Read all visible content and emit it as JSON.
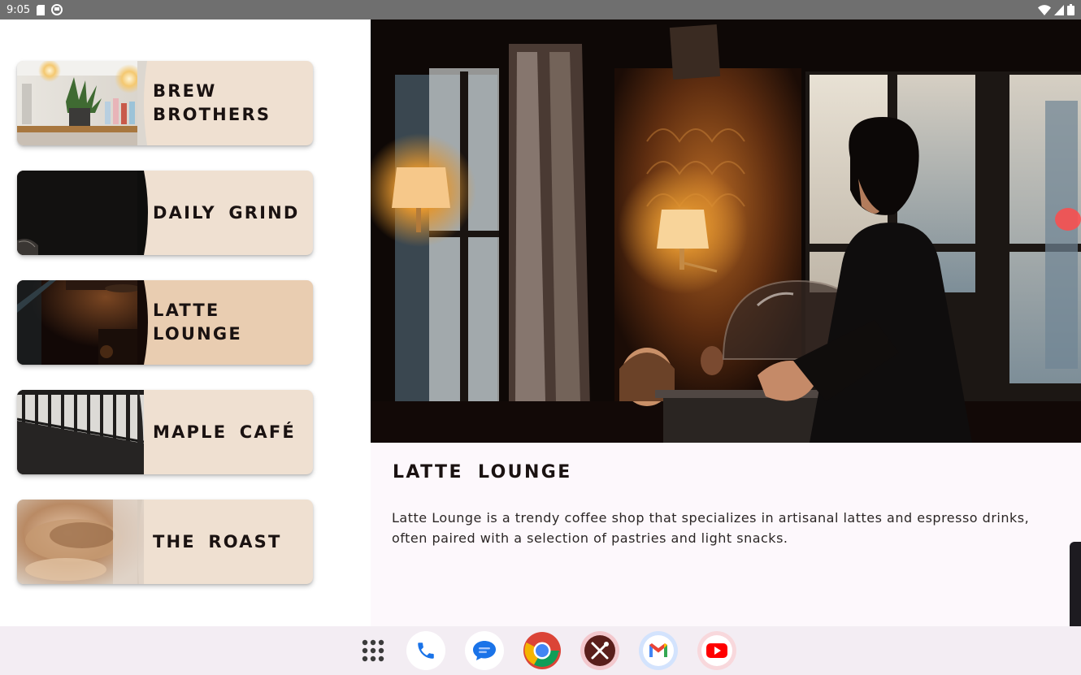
{
  "status_bar": {
    "time": "9:05"
  },
  "restaurants": [
    {
      "name": "Brew Brothers",
      "selected": false
    },
    {
      "name": "Daily Grind",
      "selected": false
    },
    {
      "name": "Latte Lounge",
      "selected": true
    },
    {
      "name": "Maple Café",
      "selected": false
    },
    {
      "name": "The Roast",
      "selected": false
    }
  ],
  "detail": {
    "title": "Latte Lounge",
    "description": "Latte Lounge is a trendy coffee shop that specializes in artisanal lattes and espresso drinks, often paired with a selection of pastries and light snacks."
  },
  "taskbar": {
    "apps": [
      {
        "icon": "app-grid-icon"
      },
      {
        "icon": "phone-icon"
      },
      {
        "icon": "messages-icon"
      },
      {
        "icon": "chrome-icon"
      },
      {
        "icon": "restaurant-app-icon"
      },
      {
        "icon": "gmail-icon"
      },
      {
        "icon": "youtube-icon"
      }
    ]
  },
  "colors": {
    "card_background": "#efe0d1",
    "card_selected_background": "#e9cdb1",
    "title_text": "#1a1211",
    "pane_background": "#fdf8fc"
  }
}
